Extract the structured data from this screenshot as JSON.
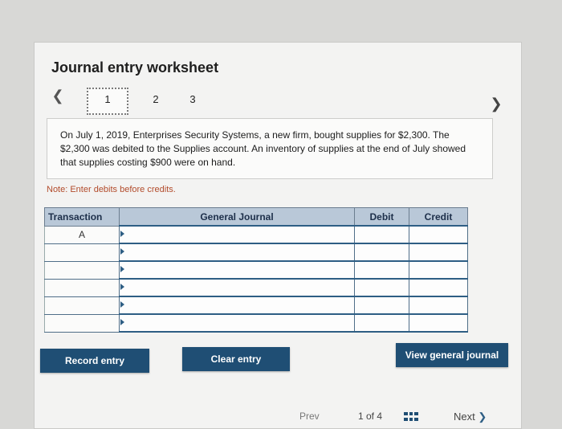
{
  "worksheet": {
    "title": "Journal entry worksheet",
    "steps": [
      "1",
      "2",
      "3"
    ],
    "active_step": "1",
    "nav_prev_icon": "chevron-left-icon",
    "nav_next_icon": "chevron-right-icon"
  },
  "problem": {
    "text": "On July 1, 2019, Enterprises Security Systems, a new firm, bought supplies for $2,300. The $2,300 was debited to the Supplies account. An inventory of supplies at the end of July showed that supplies costing $900 were on hand."
  },
  "note": "Note: Enter debits before credits.",
  "table": {
    "headers": [
      "Transaction",
      "General Journal",
      "Debit",
      "Credit"
    ],
    "rows": [
      {
        "transaction": "A",
        "journal": "",
        "debit": "",
        "credit": ""
      },
      {
        "transaction": "",
        "journal": "",
        "debit": "",
        "credit": ""
      },
      {
        "transaction": "",
        "journal": "",
        "debit": "",
        "credit": ""
      },
      {
        "transaction": "",
        "journal": "",
        "debit": "",
        "credit": ""
      },
      {
        "transaction": "",
        "journal": "",
        "debit": "",
        "credit": ""
      },
      {
        "transaction": "",
        "journal": "",
        "debit": "",
        "credit": ""
      }
    ]
  },
  "buttons": {
    "record": "Record entry",
    "clear": "Clear entry",
    "view": "View general journal"
  },
  "pager": {
    "prev": "Prev",
    "position": "1 of 4",
    "next": "Next"
  },
  "colors": {
    "button_bg": "#1f4e74",
    "header_bg": "#b9c8d8",
    "note_color": "#b24b2b"
  }
}
